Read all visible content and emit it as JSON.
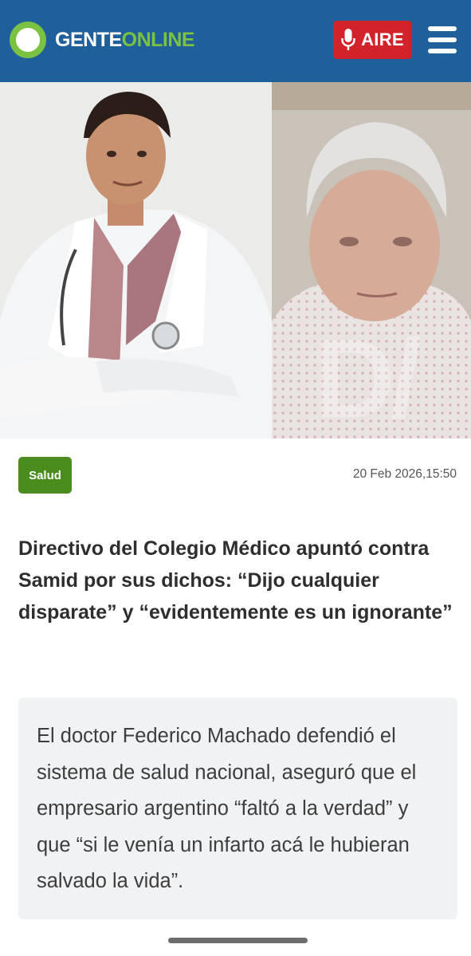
{
  "header": {
    "logo_text_white": "GENTE",
    "logo_text_green": "ONLINE",
    "live_button_label": "AIRE",
    "menu_icon": "hamburger-menu-icon",
    "colors": {
      "bar": "#1f5f9a",
      "brand_green": "#7cc242",
      "live_red": "#d3232a"
    }
  },
  "article": {
    "category": "Salud",
    "date": "20 Feb 2026,15:50",
    "title": "Directivo del Colegio Médico apuntó contra Samid por sus dichos: “Dijo cualquier disparate” y “evidentemente es un ignorante”",
    "summary": "El doctor Federico Machado defendió el sistema de salud nacional, aseguró que el empresario argentino “faltó a la verdad” y que “si le venía un infarto acá le hubieran salvado la vida”.",
    "colors": {
      "category_badge": "#4b8c1e",
      "summary_bg": "#f1f2f3"
    }
  }
}
